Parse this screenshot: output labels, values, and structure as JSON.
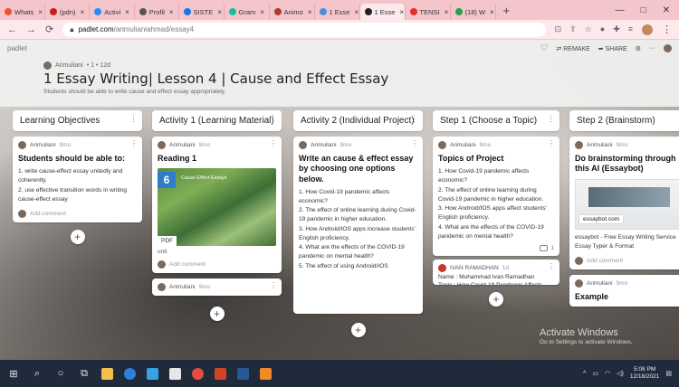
{
  "browser": {
    "tabs": [
      {
        "label": "Whats",
        "color": "#e8552f"
      },
      {
        "label": "(pdn)",
        "color": "#c5221f"
      },
      {
        "label": "Activi",
        "color": "#2d8cf0"
      },
      {
        "label": "Profil",
        "color": "#555555"
      },
      {
        "label": "SISTE",
        "color": "#1a73e8"
      },
      {
        "label": "Gram",
        "color": "#15c39a"
      },
      {
        "label": "Animo",
        "color": "#b03a2e"
      },
      {
        "label": "1 Esse",
        "color": "#4a90d9"
      },
      {
        "label": "1 Esse",
        "color": "#222222"
      },
      {
        "label": "TENSI",
        "color": "#e52d27"
      },
      {
        "label": "(18) W",
        "color": "#25a244"
      }
    ],
    "url_host": "padlet.com",
    "url_path": "/arimulianiahmad/essay4",
    "win_minimize": "—",
    "win_maximize": "□",
    "win_close": "✕"
  },
  "header": {
    "brand": "padlet",
    "remake": "REMAKE",
    "share": "SHARE",
    "author": "Arimuliani",
    "meta": "• 1 • 12d",
    "title": "1 Essay Writing| Lesson 4 | Cause and Effect Essay",
    "subtitle": "Students should be able to write cause and effect essay appropriately."
  },
  "columns": {
    "c1": {
      "title": "Learning Objectives",
      "card": {
        "author": "Arimuliani",
        "time": "9mo",
        "title": "Students should be able to:",
        "body": "1. write cause-effect essay unitedly and coherently.\n2. use effective transition words in writing cause-effect essay",
        "add_comment": "Add comment"
      }
    },
    "c2": {
      "title": "Activity 1 (Learning Material)",
      "card1": {
        "author": "Arimuliani",
        "time": "9mo",
        "title": "Reading 1",
        "thumb_num": "6",
        "thumb_label": "Cause Effect Essays",
        "pdf": "PDF",
        "unit": "unit",
        "add_comment": "Add comment"
      },
      "card2": {
        "author": "Arimuliani",
        "time": "9mo"
      }
    },
    "c3": {
      "title": "Activity 2 (Individual Project)",
      "card": {
        "author": "Arimuliani",
        "time": "9mo",
        "title": "Write an cause & effect essay by choosing one options below.",
        "body": "1. How Covid-19 pandemic affects economic?\n2. The effect of online learning during Covid-19 pandemic in higher education.\n3. How Android/IOS apps increase students' English proficiency.\n4. What are the effects of the COVID-19 pandemic on mental health?\n5. The effect of using Android/IOS"
      }
    },
    "c4": {
      "title": "Step 1 (Choose a Topic)",
      "card1": {
        "author": "Arimuliani",
        "time": "9mo",
        "title": "Topics of Project",
        "body": "1. How Covid-19 pandemic affects economic?\n2. The effect of online learning during Covid-19 pandemic in higher education.\n3. How Android/IOS apps affect students' English proficiency.\n4. What are the effects of the COVID-19 pandemic on mental health?",
        "comment_count": "1"
      },
      "card2": {
        "author": "IVAN RAMADHAN",
        "time": "1d",
        "body": "Name : Muhammad Ivan Ramadhan\nTopic : How Covid-19 Pandemic Affects"
      }
    },
    "c5": {
      "title": "Step 2 (Brainstorm)",
      "card1": {
        "author": "Arimuliani",
        "time": "9mo",
        "title": "Do brainstorming through this AI (Essaybot)",
        "tag": "essaybot.com",
        "desc": "essaybot - Free Essay Writing Service Essay Typer & Format",
        "add_comment": "Add comment"
      },
      "card2": {
        "author": "Arimuliani",
        "time": "9mo",
        "title": "Example"
      }
    }
  },
  "watermark": {
    "line1": "Activate Windows",
    "line2": "Go to Settings to activate Windows."
  },
  "taskbar": {
    "time": "5:08 PM",
    "date": "12/18/2021"
  }
}
